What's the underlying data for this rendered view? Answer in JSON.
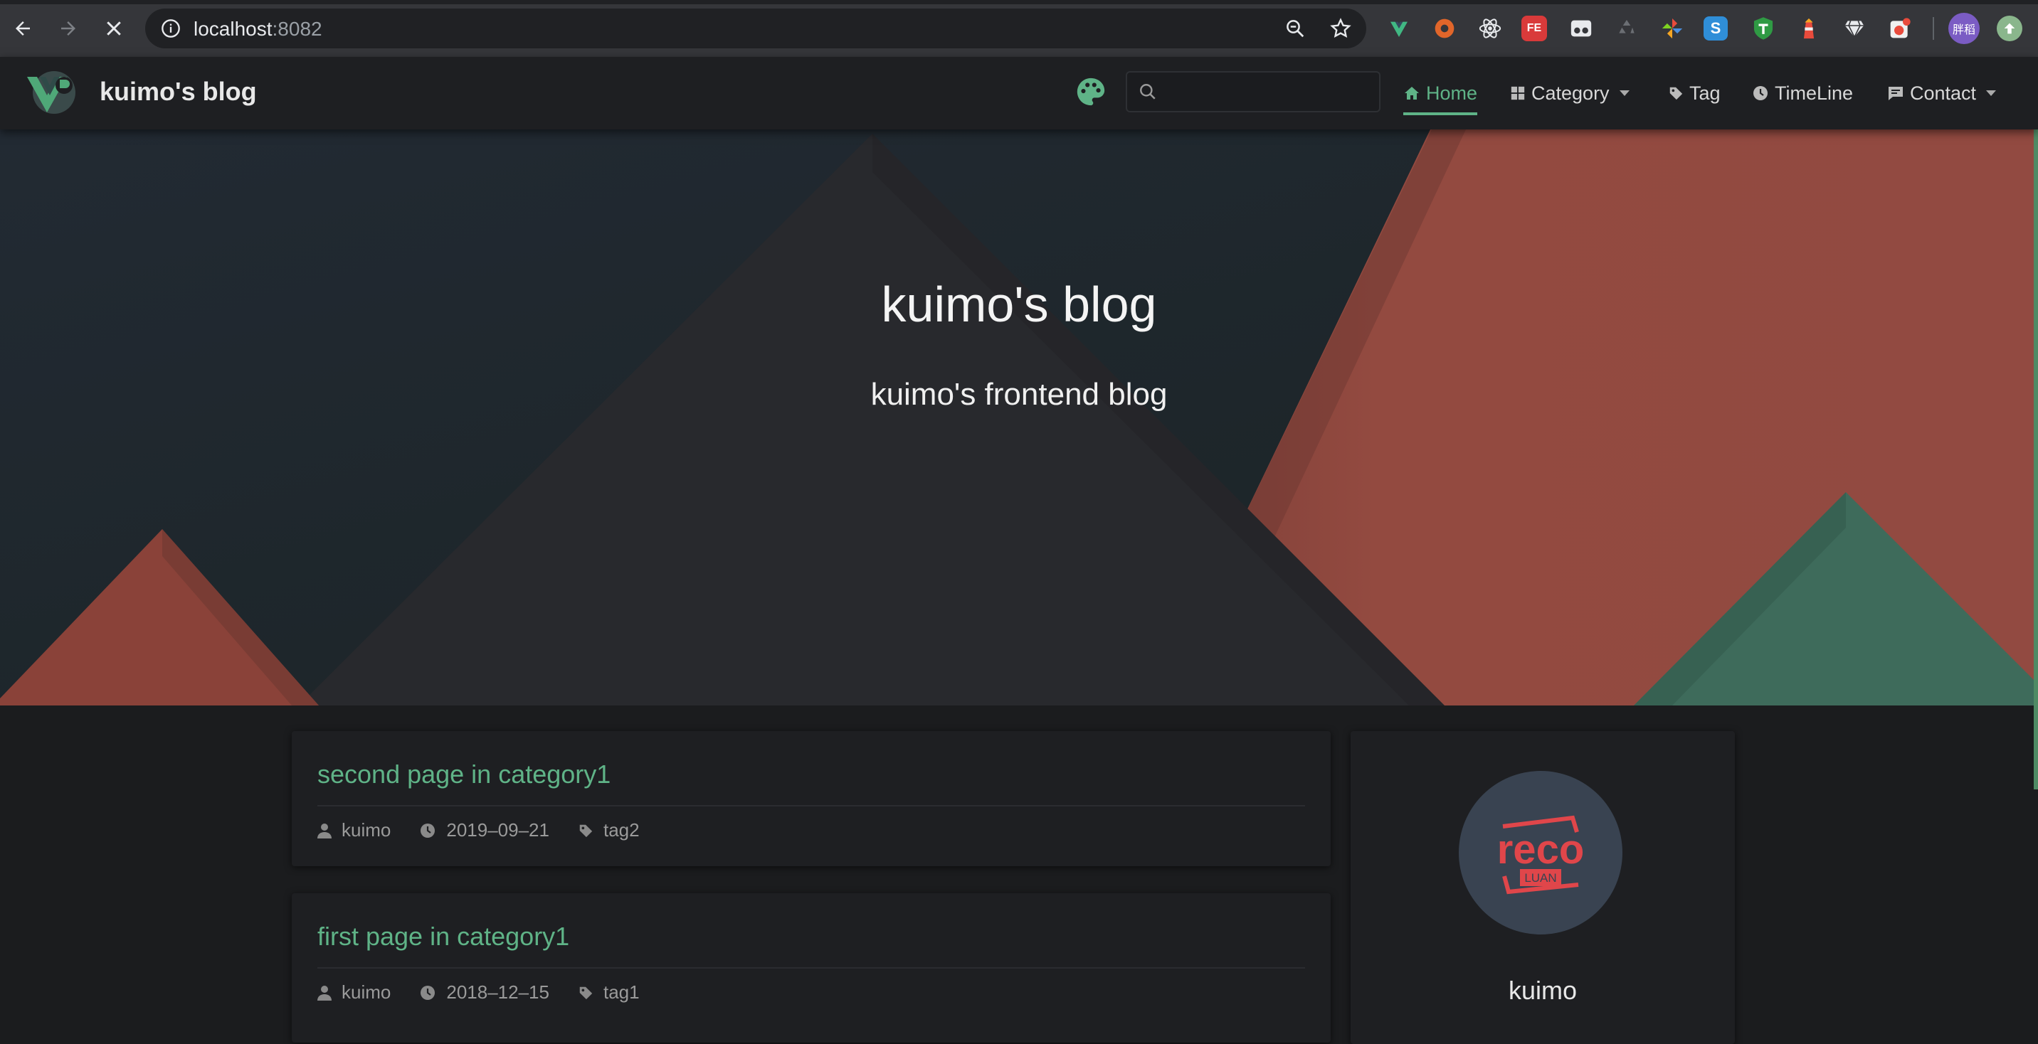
{
  "browser": {
    "url_host": "localhost",
    "url_port": ":8082",
    "extensions": [
      "vue-devtools-icon",
      "ublock-icon",
      "react-devtools-icon",
      "fe-helper-icon",
      "reader-icon",
      "recycle-icon",
      "pinwheel-icon",
      "s-icon",
      "t-shield-icon",
      "lighthouse-icon",
      "gem-icon",
      "badge-icon"
    ],
    "profile_label": "胖稻"
  },
  "navbar": {
    "site_title": "kuimo's blog",
    "search_placeholder": "",
    "items": [
      {
        "label": "Home",
        "icon": "home-icon",
        "active": true
      },
      {
        "label": "Category",
        "icon": "grid-icon",
        "dropdown": true
      },
      {
        "label": "Tag",
        "icon": "tag-icon"
      },
      {
        "label": "TimeLine",
        "icon": "clock-icon"
      },
      {
        "label": "Contact",
        "icon": "message-icon",
        "dropdown": true
      }
    ]
  },
  "hero": {
    "title": "kuimo's blog",
    "subtitle": "kuimo's frontend blog"
  },
  "posts": [
    {
      "title": "second page in category1",
      "author": "kuimo",
      "date": "2019–09–21",
      "tag": "tag2"
    },
    {
      "title": "first page in category1",
      "author": "kuimo",
      "date": "2018–12–15",
      "tag": "tag1"
    }
  ],
  "sidebar": {
    "avatar_text_top": "reco",
    "avatar_text_bottom": "LUAN",
    "author_name": "kuimo"
  },
  "colors": {
    "accent": "#5fb387",
    "hero_red": "#924a40",
    "hero_green": "#3e6b5b",
    "hero_dark": "#28292d",
    "avatar_red": "#e0464a"
  }
}
